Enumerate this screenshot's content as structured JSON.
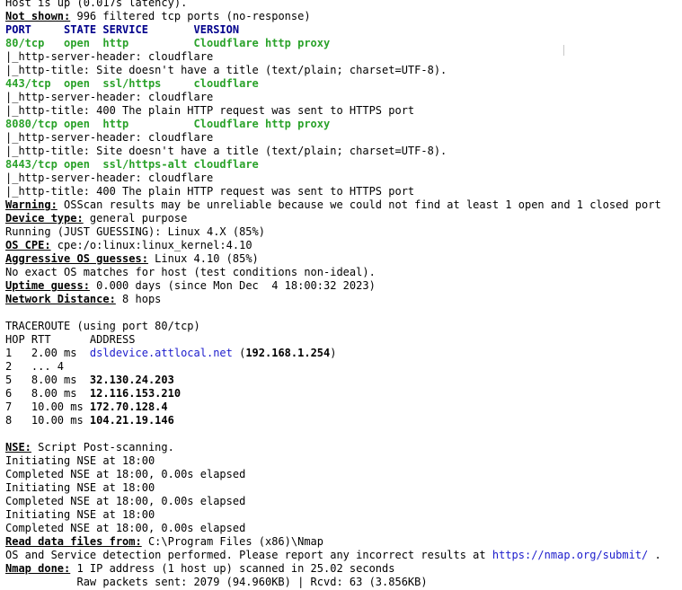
{
  "lines": {
    "top_partial": "Host is up (0.017s latency).",
    "not_shown_label": "Not shown:",
    "not_shown_value": " 996 filtered tcp ports (no-response)",
    "table_header": "PORT     STATE SERVICE       VERSION",
    "p80_port": "80/tcp   open  http          ",
    "p80_version": "Cloudflare http proxy",
    "p80_l1": "|_http-server-header: cloudflare",
    "p80_l2": "|_http-title: Site doesn't have a title (text/plain; charset=UTF-8).",
    "p443_port": "443/tcp  open  ssl/https     ",
    "p443_version": "cloudflare",
    "p443_l1": "|_http-server-header: cloudflare",
    "p443_l2": "|_http-title: 400 The plain HTTP request was sent to HTTPS port",
    "p8080_port": "8080/tcp open  http          ",
    "p8080_version": "Cloudflare http proxy",
    "p8080_l1": "|_http-server-header: cloudflare",
    "p8080_l2": "|_http-title: Site doesn't have a title (text/plain; charset=UTF-8).",
    "p8443_port": "8443/tcp open  ssl/https-alt ",
    "p8443_version": "cloudflare",
    "p8443_l1": "|_http-server-header: cloudflare",
    "p8443_l2": "|_http-title: 400 The plain HTTP request was sent to HTTPS port",
    "warning_label": "Warning:",
    "warning_value": " OSScan results may be unreliable because we could not find at least 1 open and 1 closed port",
    "device_label": "Device type:",
    "device_value": " general purpose",
    "running": "Running (JUST GUESSING): Linux 4.X (85%)",
    "oscpe_label": "OS CPE:",
    "oscpe_value": " cpe:/o:linux:linux_kernel:4.10",
    "aggressive_label": "Aggressive OS guesses:",
    "aggressive_value": " Linux 4.10 (85%)",
    "no_exact": "No exact OS matches for host (test conditions non-ideal).",
    "uptime_label": "Uptime guess:",
    "uptime_value": " 0.000 days (since Mon Dec  4 18:00:32 2023)",
    "distance_label": "Network Distance:",
    "distance_value": " 8 hops",
    "traceroute": "TRACEROUTE (using port 80/tcp)",
    "tr_header": "HOP RTT      ADDRESS",
    "hop1_prefix": "1   2.00 ms  ",
    "hop1_host": "dsldevice.attlocal.net",
    "hop1_mid": " (",
    "hop1_ip": "192.168.1.254",
    "hop1_end": ")",
    "hop2": "2   ... 4",
    "hop5_prefix": "5   8.00 ms  ",
    "hop5_ip": "32.130.24.203",
    "hop6_prefix": "6   8.00 ms  ",
    "hop6_ip": "12.116.153.210",
    "hop7_prefix": "7   10.00 ms ",
    "hop7_ip": "172.70.128.4",
    "hop8_prefix": "8   10.00 ms ",
    "hop8_ip": "104.21.19.146",
    "nse_label": "NSE:",
    "nse_value": " Script Post-scanning.",
    "init1": "Initiating NSE at 18:00",
    "comp1": "Completed NSE at 18:00, 0.00s elapsed",
    "init2": "Initiating NSE at 18:00",
    "comp2": "Completed NSE at 18:00, 0.00s elapsed",
    "init3": "Initiating NSE at 18:00",
    "comp3": "Completed NSE at 18:00, 0.00s elapsed",
    "readdata_label": "Read data files from:",
    "readdata_value": " C:\\Program Files (x86)\\Nmap",
    "osdet_text": "OS and Service detection performed. Please report any incorrect results at ",
    "osdet_link": "https://nmap.org/submit/",
    "osdet_end": " .",
    "done_label": "Nmap done:",
    "done_value": " 1 IP address (1 host up) scanned in 25.02 seconds",
    "raw_packets": "           Raw packets sent: 2079 (94.960KB) | Rcvd: 63 (3.856KB)"
  },
  "colors": {
    "header": "#00008b",
    "port": "#2aa22a",
    "link": "#1c1ccc"
  }
}
